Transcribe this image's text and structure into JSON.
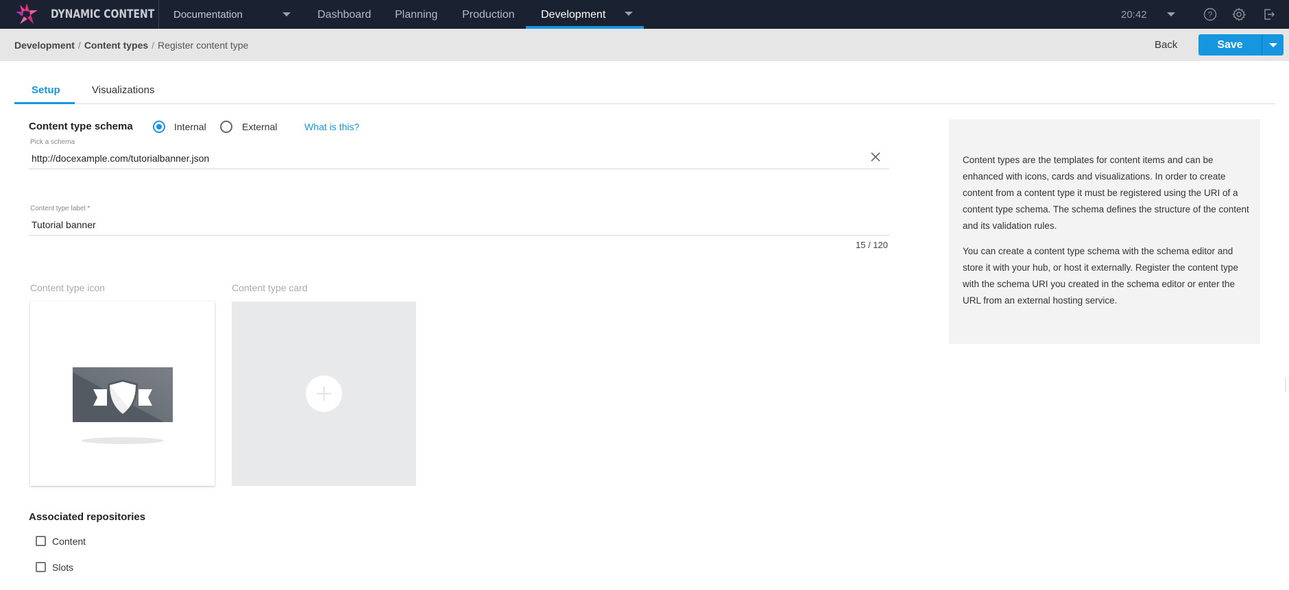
{
  "app": {
    "brand": "DYNAMIC CONTENT",
    "hub_selector": "Documentation",
    "nav": [
      {
        "label": "Dashboard",
        "active": false
      },
      {
        "label": "Planning",
        "active": false
      },
      {
        "label": "Production",
        "active": false
      },
      {
        "label": "Development",
        "active": true
      }
    ],
    "clock": "20:42",
    "icons": [
      "help-icon",
      "settings-icon",
      "logout-icon"
    ],
    "accent_color": "#1696de"
  },
  "breadcrumb": {
    "items": [
      "Development",
      "Content types",
      "Register content type"
    ],
    "separator": "/"
  },
  "actions": {
    "back_label": "Back",
    "save_label": "Save"
  },
  "tabs": [
    {
      "label": "Setup",
      "active": true
    },
    {
      "label": "Visualizations",
      "active": false
    }
  ],
  "form": {
    "schema_title": "Content type schema",
    "schema_options": [
      {
        "label": "Internal",
        "selected": true
      },
      {
        "label": "External",
        "selected": false
      }
    ],
    "what_is_this": "What is this?",
    "schema_field": {
      "label": "Pick a schema",
      "value": "http://docexample.com/tutorialbanner.json"
    },
    "label_field": {
      "label": "Content type label *",
      "value": "Tutorial banner",
      "counter": "15 / 120"
    },
    "icon_section_label": "Content type icon",
    "card_section_label": "Content type card",
    "associated_title": "Associated repositories",
    "repositories": [
      {
        "label": "Content",
        "checked": false
      },
      {
        "label": "Slots",
        "checked": false
      }
    ]
  },
  "info": {
    "paragraphs": [
      "Content types are the templates for content items and can be enhanced with icons, cards and visualizations. In order to create content from a content type it must be registered using the URI of a content type schema. The schema defines the structure of the content and its validation rules.",
      "You can create a content type schema with the schema editor and store it with your hub, or host it externally. Register the content type with the schema URI you created in the schema editor or enter the URL from an external hosting service."
    ]
  }
}
